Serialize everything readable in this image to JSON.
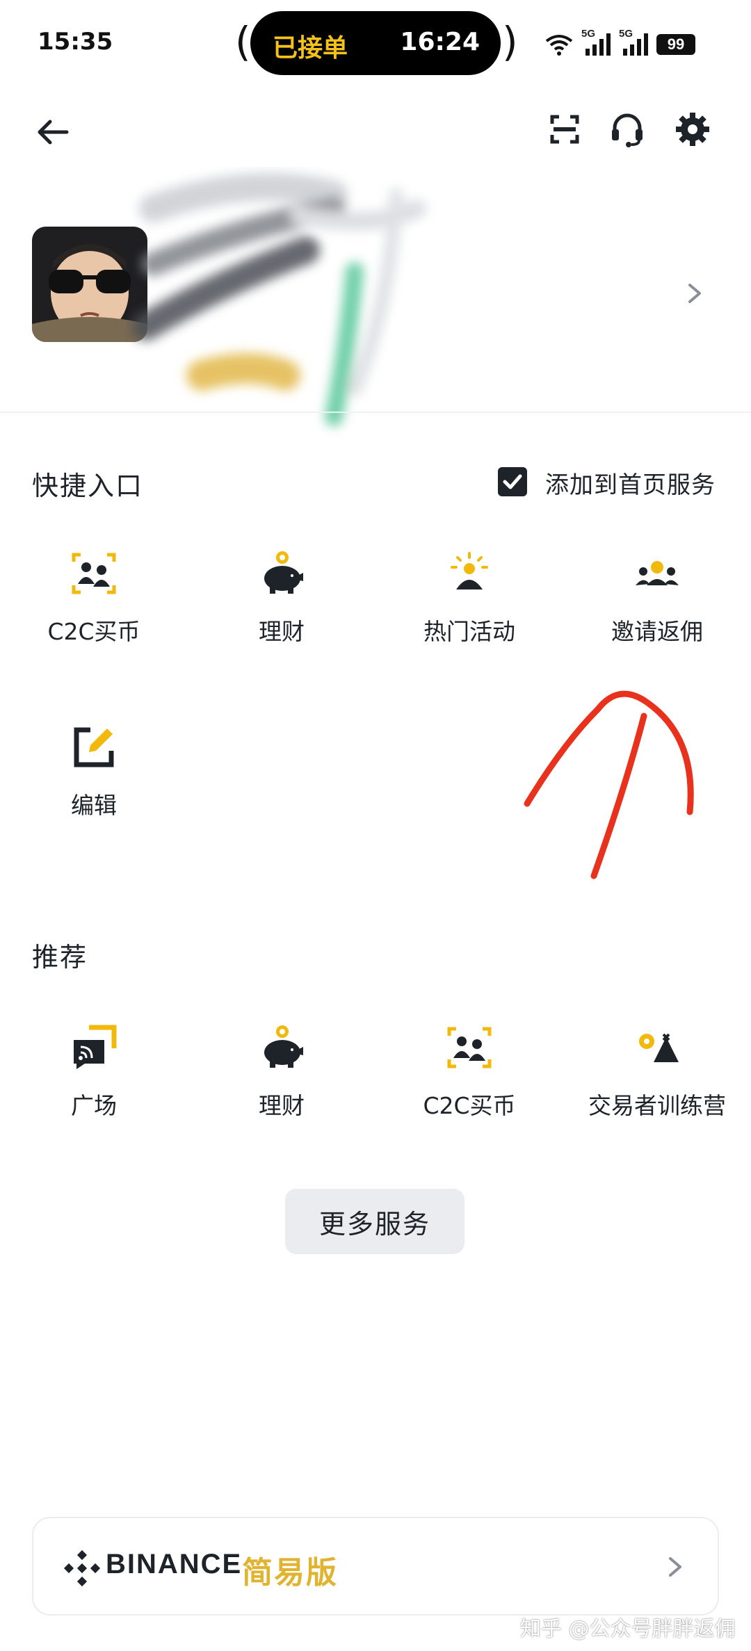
{
  "status_bar": {
    "time": "15:35",
    "island_label": "已接单",
    "island_time": "16:24",
    "network_1": "5G",
    "network_2": "5G",
    "battery": "99"
  },
  "header": {
    "icons": [
      "back-arrow-icon",
      "scan-icon",
      "headset-icon",
      "settings-icon"
    ]
  },
  "quick_access": {
    "title": "快捷入口",
    "add_to_home": "添加到首页服务",
    "add_to_home_checked": true,
    "items": [
      {
        "label": "C2C买币",
        "icon": "c2c-users-icon"
      },
      {
        "label": "理财",
        "icon": "piggy-bank-icon"
      },
      {
        "label": "热门活动",
        "icon": "hot-activity-icon"
      },
      {
        "label": "邀请返佣",
        "icon": "referral-group-icon"
      },
      {
        "label": "编辑",
        "icon": "edit-icon"
      }
    ]
  },
  "recommend": {
    "title": "推荐",
    "items": [
      {
        "label": "广场",
        "icon": "square-feed-icon"
      },
      {
        "label": "理财",
        "icon": "piggy-bank-icon"
      },
      {
        "label": "C2C买币",
        "icon": "c2c-users-icon"
      },
      {
        "label": "交易者训练营",
        "icon": "trader-camp-icon"
      }
    ]
  },
  "more_services": "更多服务",
  "lite_card": {
    "brand": "BINANCE",
    "mode": "简易版"
  },
  "watermark": "知乎 @公众号胖胖返佣",
  "colors": {
    "accent_yellow": "#F0B90B",
    "text_primary": "#1E2329",
    "annotation_red": "#E8321E"
  }
}
